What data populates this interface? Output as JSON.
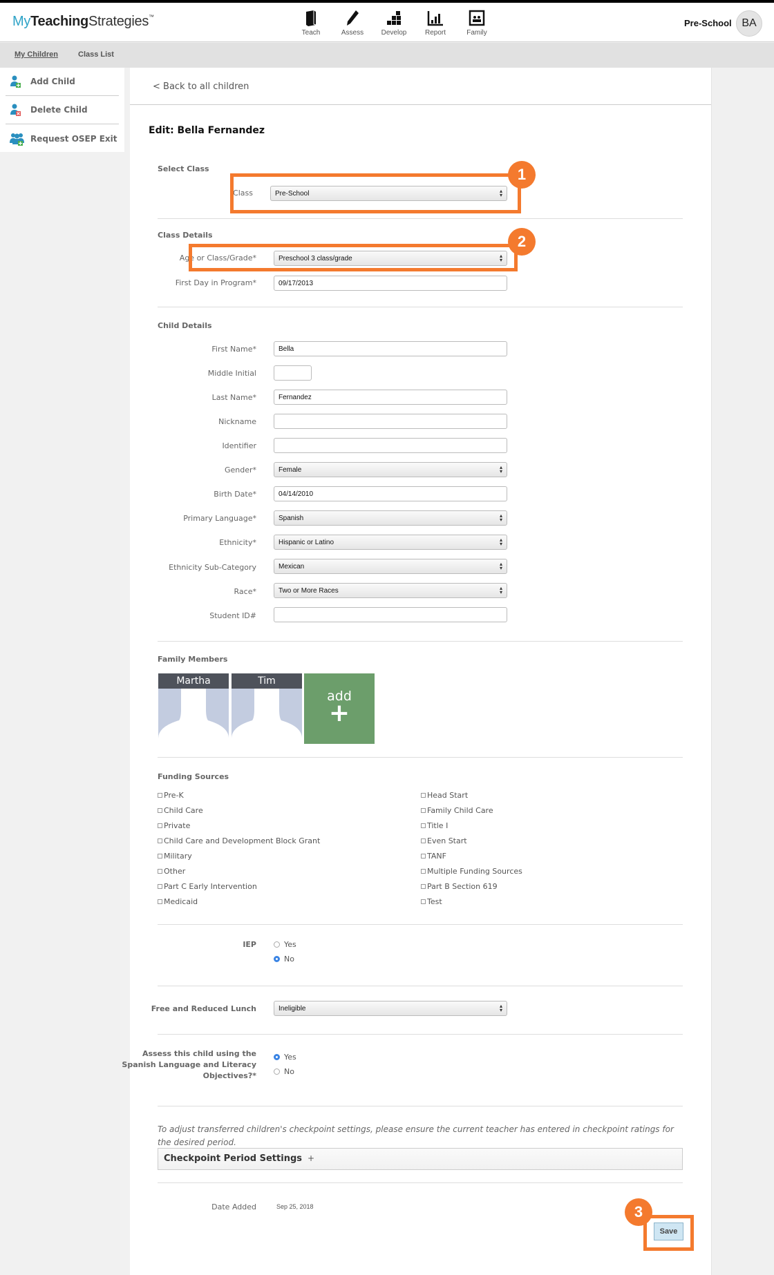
{
  "header": {
    "logo": {
      "my": "My",
      "teaching": "Teaching",
      "strategies": "Strategies",
      "tm": "™"
    },
    "nav": [
      {
        "label": "Teach",
        "icon": "book-icon"
      },
      {
        "label": "Assess",
        "icon": "pencil-icon"
      },
      {
        "label": "Develop",
        "icon": "blocks-icon"
      },
      {
        "label": "Report",
        "icon": "bar-chart-icon"
      },
      {
        "label": "Family",
        "icon": "family-photo-icon"
      }
    ],
    "account_name": "Pre-School",
    "avatar_initials": "BA"
  },
  "subnav": {
    "my_children": "My Children",
    "class_list": "Class List"
  },
  "sidebar": {
    "items": [
      {
        "label": "Add Child",
        "icon": "add-person-icon"
      },
      {
        "label": "Delete Child",
        "icon": "delete-person-icon"
      },
      {
        "label": "Request OSEP Exit",
        "icon": "group-add-icon"
      }
    ]
  },
  "main": {
    "back_link": "< Back to all children",
    "title": "Edit: Bella Fernandez",
    "select_class": {
      "section": "Select Class",
      "class_label": "Class",
      "class_value": "Pre-School"
    },
    "class_details": {
      "section": "Class Details",
      "age_label": "Age or Class/Grade*",
      "age_value": "Preschool 3 class/grade",
      "first_day_label": "First Day in Program*",
      "first_day_value": "09/17/2013"
    },
    "child_details": {
      "section": "Child Details",
      "first_name_label": "First Name*",
      "first_name_value": "Bella",
      "middle_initial_label": "Middle Initial",
      "middle_initial_value": "",
      "last_name_label": "Last Name*",
      "last_name_value": "Fernandez",
      "nickname_label": "Nickname",
      "nickname_value": "",
      "identifier_label": "Identifier",
      "identifier_value": "",
      "gender_label": "Gender*",
      "gender_value": "Female",
      "birth_date_label": "Birth Date*",
      "birth_date_value": "04/14/2010",
      "language_label": "Primary Language*",
      "language_value": "Spanish",
      "ethnicity_label": "Ethnicity*",
      "ethnicity_value": "Hispanic or Latino",
      "ethnicity_sub_label": "Ethnicity Sub-Category",
      "ethnicity_sub_value": "Mexican",
      "race_label": "Race*",
      "race_value": "Two or More Races",
      "student_id_label": "Student ID#",
      "student_id_value": ""
    },
    "family": {
      "section": "Family Members",
      "members": [
        {
          "name": "Martha"
        },
        {
          "name": "Tim"
        }
      ],
      "add_label": "add",
      "add_symbol": "+"
    },
    "funding": {
      "section": "Funding Sources",
      "left": [
        "Pre-K",
        "Child Care",
        "Private",
        "Child Care and Development Block Grant",
        "Military",
        "Other",
        "Part C Early Intervention",
        "Medicaid"
      ],
      "right": [
        "Head Start",
        "Family Child Care",
        "Title I",
        "Even Start",
        "TANF",
        "Multiple Funding Sources",
        "Part B Section 619",
        "Test"
      ]
    },
    "iep": {
      "label": "IEP",
      "options": [
        "Yes",
        "No"
      ],
      "selected": "No"
    },
    "lunch": {
      "label": "Free and Reduced Lunch",
      "value": "Ineligible"
    },
    "spanish": {
      "label": "Assess this child using the Spanish Language and Literacy Objectives?*",
      "options": [
        "Yes",
        "No"
      ],
      "selected": "Yes"
    },
    "checkpoint_note": "To adjust transferred children's checkpoint settings, please ensure the current teacher has entered in checkpoint ratings for the desired period.",
    "checkpoint_title": "Checkpoint Period Settings",
    "checkpoint_plus": "+",
    "date_added_label": "Date Added",
    "date_added_value": "Sep 25, 2018",
    "save_label": "Save"
  },
  "callouts": {
    "one": "1",
    "two": "2",
    "three": "3"
  },
  "colors": {
    "accent": "#f47a2e",
    "brand_blue": "#2ea3c7",
    "add_green": "#6c9e6b",
    "radio_blue": "#3a84e4"
  }
}
